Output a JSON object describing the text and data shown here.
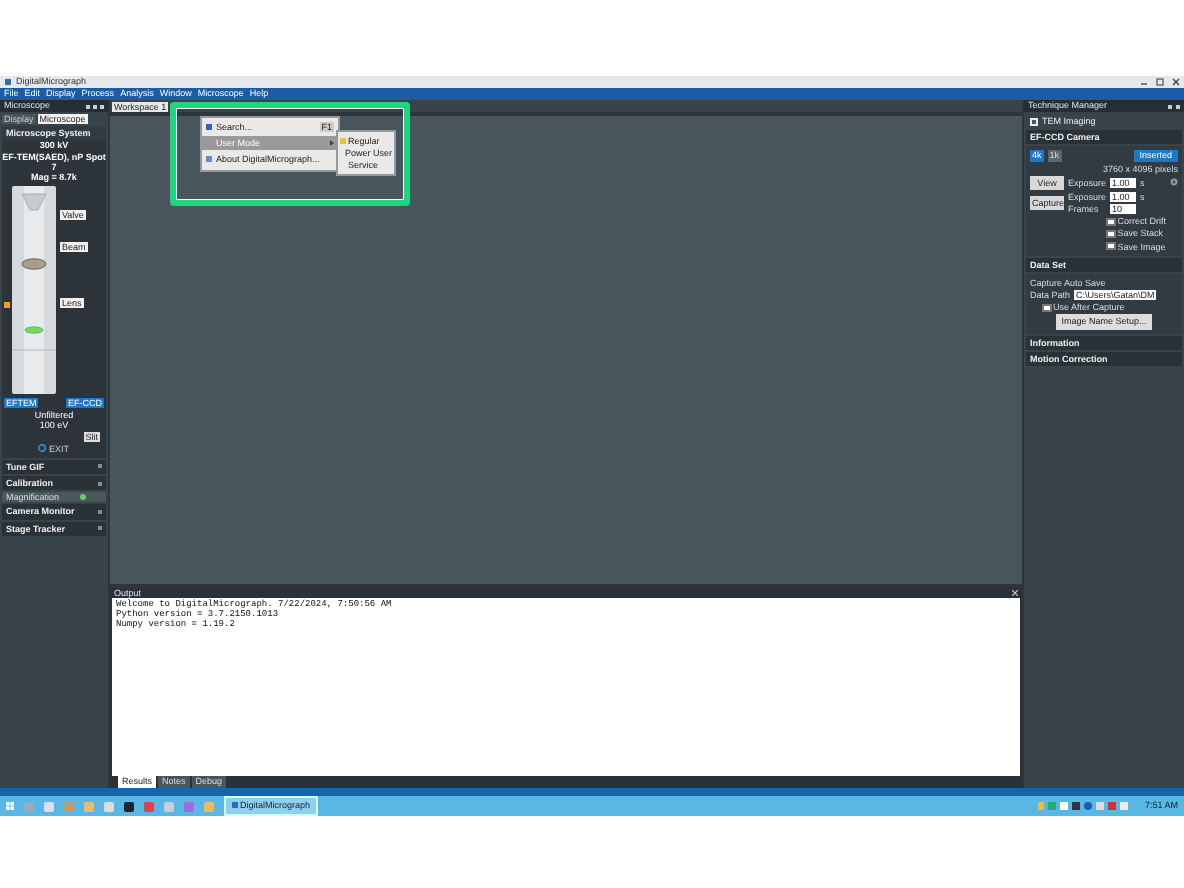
{
  "window": {
    "title": "DigitalMicrograph"
  },
  "menu": [
    "File",
    "Edit",
    "Display",
    "Process",
    "Analysis",
    "Window",
    "Microscope",
    "Help"
  ],
  "left_panel": {
    "title": "Microscope",
    "tabs": [
      {
        "label": "Display",
        "selected": false
      },
      {
        "label": "Microscope",
        "selected": true
      }
    ],
    "system": {
      "title": "Microscope System",
      "lines": [
        "300 kV",
        "EF-TEM(SAED), nP Spot 7",
        "Mag = 8.7k"
      ],
      "column_buttons": [
        "Valve",
        "Beam",
        "Lens"
      ],
      "mode_left": "EFTEM",
      "mode_right": "EF-CCD",
      "filter_lines": [
        "Unfiltered",
        "100 eV"
      ],
      "small_button": "Slit",
      "exit": "EXIT"
    },
    "sections": [
      {
        "title": "Tune GIF"
      },
      {
        "title": "Calibration",
        "rows": [
          {
            "label": "Magnification",
            "ok": true
          }
        ]
      },
      {
        "title": "Camera Monitor"
      },
      {
        "title": "Stage Tracker"
      }
    ]
  },
  "workspace": {
    "tab": "Workspace 1",
    "popup_menu": [
      {
        "label": "Search...",
        "shortcut": "F1",
        "selected": false,
        "submenu": false
      },
      {
        "label": "User Mode",
        "selected": true,
        "submenu": true
      },
      {
        "label": "About DigitalMicrograph...",
        "selected": false,
        "submenu": false
      }
    ],
    "submenu": [
      {
        "label": "Regular",
        "checked": true
      },
      {
        "label": "Power User",
        "checked": false
      },
      {
        "label": "Service",
        "checked": false
      }
    ]
  },
  "output": {
    "title": "Output",
    "lines": [
      "Welcome to DigitalMicrograph.  7/22/2024, 7:50:56 AM",
      "Python version = 3.7.2150.1013",
      "Numpy version = 1.19.2"
    ],
    "tabs": [
      {
        "label": "Results",
        "selected": true
      },
      {
        "label": "Notes",
        "selected": false
      },
      {
        "label": "Debug",
        "selected": false
      }
    ]
  },
  "right_panel": {
    "title": "Technique Manager",
    "technique": "TEM Imaging",
    "camera": {
      "title": "EF-CCD Camera",
      "modes": [
        {
          "label": "4k",
          "selected": true
        },
        {
          "label": "1k",
          "selected": false
        }
      ],
      "state_button": "Inserted",
      "size": "3760 x 4096 pixels",
      "view": {
        "button": "View",
        "exposure_label": "Exposure",
        "exposure": "1.00",
        "unit": "s"
      },
      "capture": {
        "button": "Capture",
        "exposure_label": "Exposure",
        "exposure": "1.00",
        "unit": "s",
        "frames_label": "Frames",
        "frames": "10"
      },
      "options": [
        {
          "label": "Correct Drift",
          "checked": false
        },
        {
          "label": "Save Stack",
          "checked": false
        },
        {
          "label": "Save Image",
          "checked": false
        }
      ]
    },
    "data_set": {
      "title": "Data Set",
      "group": "Capture Auto Save",
      "path_label": "Data Path",
      "path": "C:\\Users\\Gatan\\DM",
      "use_after": {
        "label": "Use After Capture",
        "checked": false
      },
      "name_button": "Image Name Setup..."
    },
    "sections": [
      "Information",
      "Motion Correction"
    ]
  },
  "taskbar": {
    "app": "DigitalMicrograph",
    "time": "7:51 AM"
  }
}
